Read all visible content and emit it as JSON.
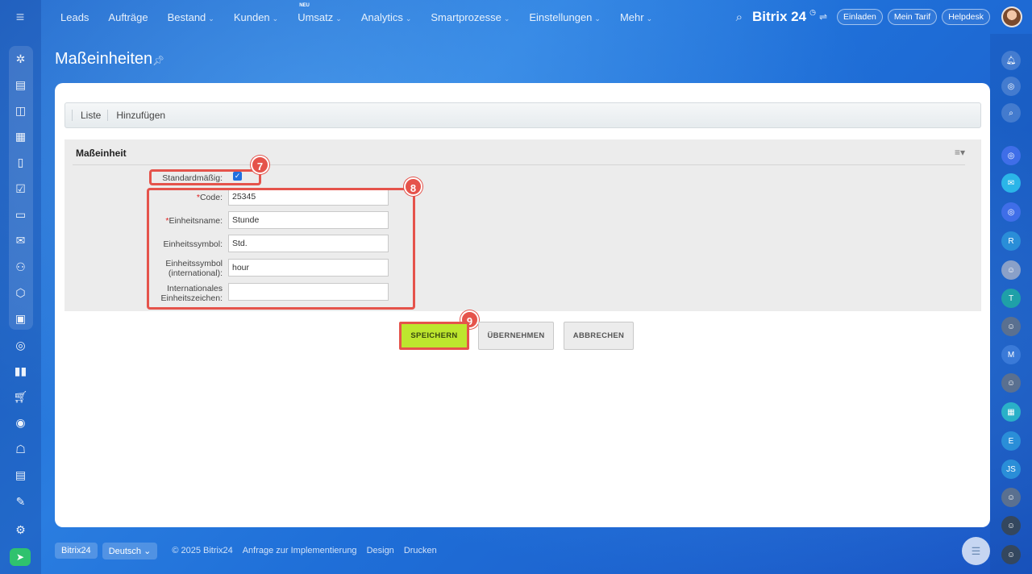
{
  "nav": {
    "items": [
      {
        "label": "Leads",
        "chevron": false
      },
      {
        "label": "Aufträge",
        "chevron": false
      },
      {
        "label": "Bestand",
        "chevron": true
      },
      {
        "label": "Kunden",
        "chevron": true
      },
      {
        "label": "Umsatz",
        "chevron": true,
        "badge": "NEU"
      },
      {
        "label": "Analytics",
        "chevron": true
      },
      {
        "label": "Smartprozesse",
        "chevron": true
      },
      {
        "label": "Einstellungen",
        "chevron": true
      },
      {
        "label": "Mehr",
        "chevron": true
      }
    ],
    "logo": "Bitrix 24",
    "invite": "Einladen",
    "my_plan": "Mein Tarif",
    "helpdesk": "Helpdesk"
  },
  "page": {
    "title": "Maßeinheiten"
  },
  "tabs": {
    "list": "Liste",
    "add": "Hinzufügen"
  },
  "form": {
    "heading": "Maßeinheit",
    "default_label": "Standardmäßig:",
    "default_checked": true,
    "code_label": "Code:",
    "code_value": "25345",
    "name_label": "Einheitsname:",
    "name_value": "Stunde",
    "symbol_label": "Einheitssymbol:",
    "symbol_value": "Std.",
    "symbol_intl_label_1": "Einheitssymbol",
    "symbol_intl_label_2": "(international):",
    "symbol_intl_value": "hour",
    "intl_char_label_1": "Internationales",
    "intl_char_label_2": "Einheitszeichen:",
    "intl_char_value": ""
  },
  "markers": {
    "m7": "7",
    "m8": "8",
    "m9": "9"
  },
  "buttons": {
    "save": "SPEICHERN",
    "apply": "ÜBERNEHMEN",
    "cancel": "ABBRECHEN"
  },
  "footer": {
    "brand": "Bitrix24",
    "language": "Deutsch",
    "copyright": "© 2025 Bitrix24",
    "link_implementation": "Anfrage zur Implementierung",
    "link_design": "Design",
    "link_print": "Drucken"
  },
  "right_bar": {
    "avatars": [
      "R",
      "T",
      "M",
      "E",
      "JS"
    ]
  },
  "colors": {
    "accent_red": "#e5534b",
    "save_green": "#bde62e",
    "brand_blue": "#1f6fd8"
  }
}
